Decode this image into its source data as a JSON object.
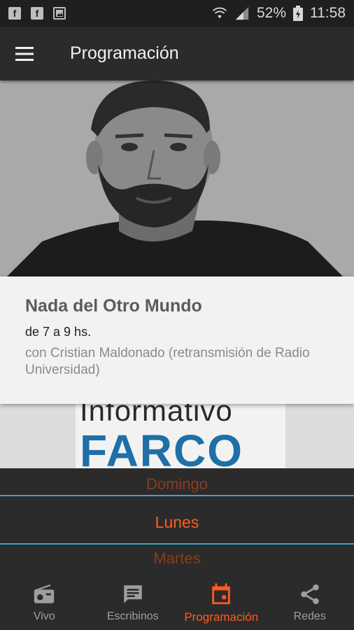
{
  "status_bar": {
    "battery": "52%",
    "time": "11:58"
  },
  "app_bar": {
    "title": "Programación"
  },
  "program": {
    "title": "Nada del Otro Mundo",
    "time": "de 7 a 9 hs.",
    "description": "con Cristian Maldonado (retransmisión de Radio Universidad)"
  },
  "next_program_image": {
    "line1": "Informativo",
    "line2": "FARCO"
  },
  "day_picker": {
    "previous": "Domingo",
    "selected": "Lunes",
    "next": "Martes"
  },
  "bottom_nav": {
    "items": [
      {
        "label": "Vivo",
        "icon": "radio-icon"
      },
      {
        "label": "Escribinos",
        "icon": "message-icon"
      },
      {
        "label": "Programación",
        "icon": "calendar-icon"
      },
      {
        "label": "Redes",
        "icon": "share-icon"
      }
    ],
    "active_color": "#ff5a1f",
    "inactive_color": "#9e9e9e"
  }
}
